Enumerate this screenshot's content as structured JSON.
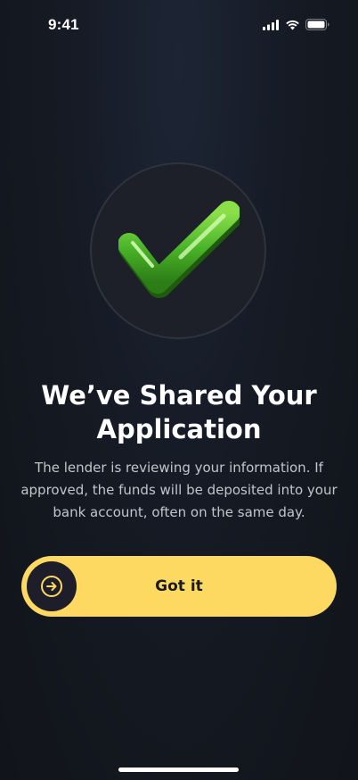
{
  "status_bar": {
    "time": "9:41",
    "icons": [
      "cellular-signal-icon",
      "wifi-icon",
      "battery-icon"
    ]
  },
  "hero": {
    "icon": "green-checkmark-icon"
  },
  "title": "We’ve Shared Your Application",
  "subtitle": "The lender is reviewing your information. If approved, the funds will be deposited into your bank account, often on the same day.",
  "primary_button": {
    "label": "Got it",
    "icon": "arrow-right-circle-icon",
    "color": "#fdd962"
  },
  "colors": {
    "background": "#151a24",
    "accent": "#fdd962",
    "check_green": "#4caf2a"
  }
}
